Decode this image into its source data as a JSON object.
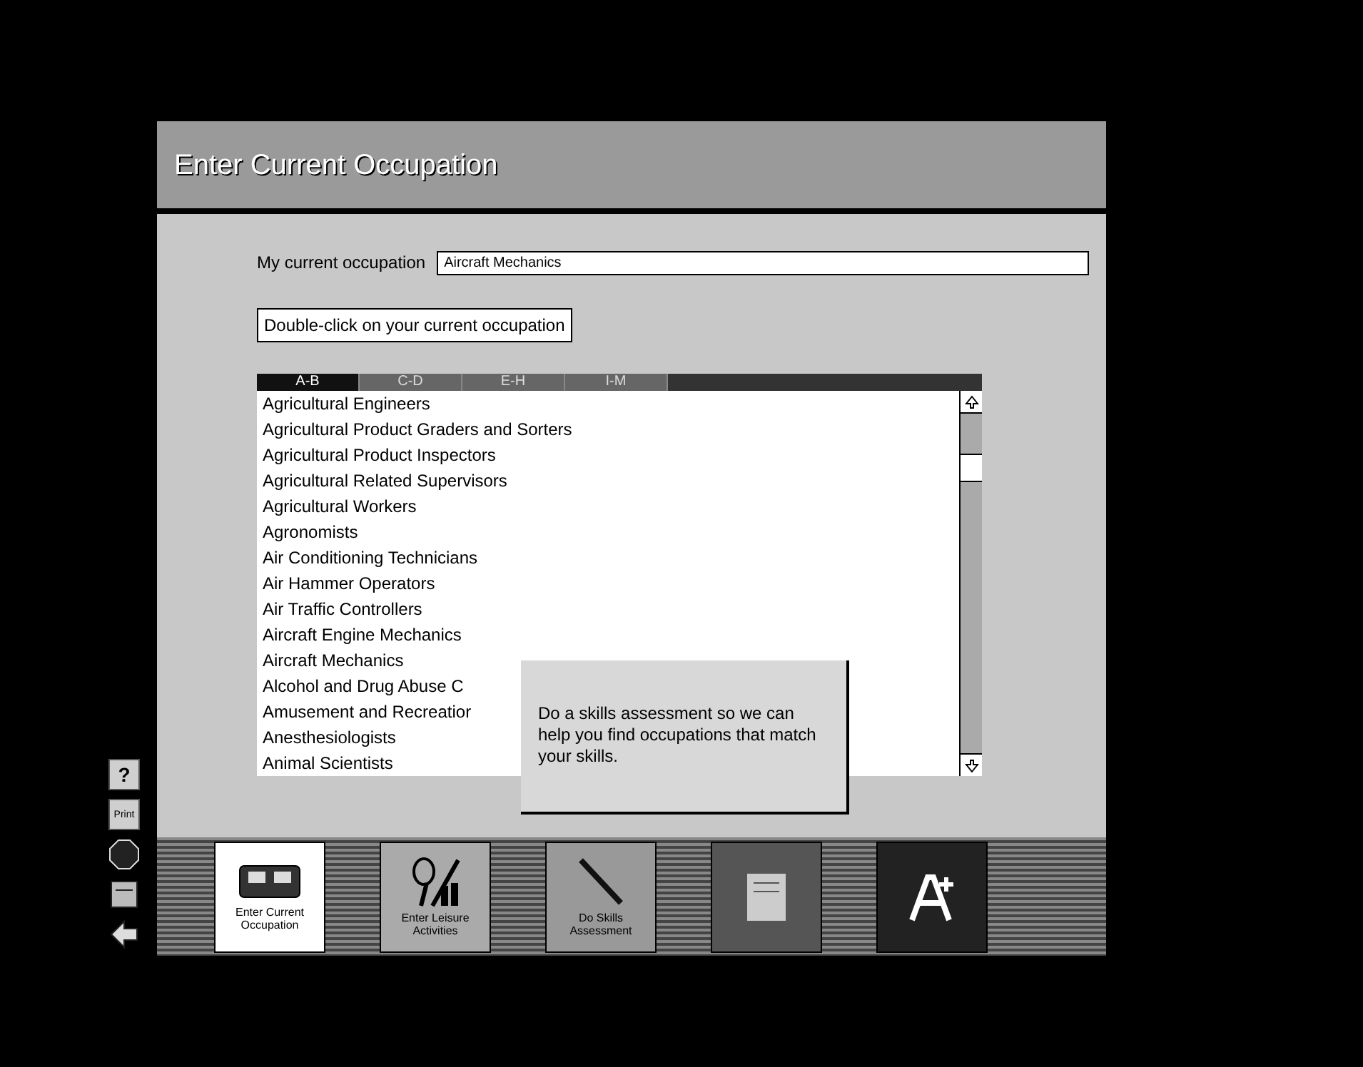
{
  "window": {
    "title": "Enter Current Occupation"
  },
  "occupation_field": {
    "label": "My current occupation",
    "value": "Aircraft Mechanics"
  },
  "instruction": "Double-click on your current occupation",
  "letter_tabs": [
    {
      "label": "A-B",
      "selected": true
    },
    {
      "label": "C-D",
      "selected": false
    },
    {
      "label": "E-H",
      "selected": false
    },
    {
      "label": "I-M",
      "selected": false
    }
  ],
  "occupations": [
    {
      "label": "Agricultural Engineers",
      "selected": false
    },
    {
      "label": "Agricultural Product Graders and Sorters",
      "selected": false
    },
    {
      "label": "Agricultural Product Inspectors",
      "selected": false
    },
    {
      "label": "Agricultural Related Supervisors",
      "selected": false
    },
    {
      "label": "Agricultural Workers",
      "selected": false
    },
    {
      "label": "Agronomists",
      "selected": false
    },
    {
      "label": "Air Conditioning Technicians",
      "selected": false
    },
    {
      "label": "Air Hammer Operators",
      "selected": false
    },
    {
      "label": "Air Traffic Controllers",
      "selected": false
    },
    {
      "label": "Aircraft Engine Mechanics",
      "selected": false
    },
    {
      "label": "Aircraft Mechanics",
      "selected": false
    },
    {
      "label": "Alcohol and Drug Abuse C",
      "selected": false
    },
    {
      "label": "Amusement and Recreatior",
      "selected": false
    },
    {
      "label": "Anesthesiologists",
      "selected": false
    },
    {
      "label": "Animal Scientists",
      "selected": false
    }
  ],
  "tooltip": "Do a skills assessment so we can help you find occupations that match your skills.",
  "side_tools": [
    {
      "kind": "help",
      "label": "?"
    },
    {
      "kind": "print",
      "label": "Print"
    },
    {
      "kind": "stop"
    },
    {
      "kind": "notes"
    },
    {
      "kind": "back"
    }
  ],
  "nav_buttons": [
    {
      "kind": "occupation",
      "label": "Enter Current Occupation",
      "selected": true
    },
    {
      "kind": "leisure",
      "label": "Enter Leisure Activities",
      "selected": false
    },
    {
      "kind": "skills",
      "label": "Do Skills Assessment",
      "selected": false
    },
    {
      "kind": "report",
      "selected": false
    },
    {
      "kind": "grade",
      "selected": false
    }
  ]
}
